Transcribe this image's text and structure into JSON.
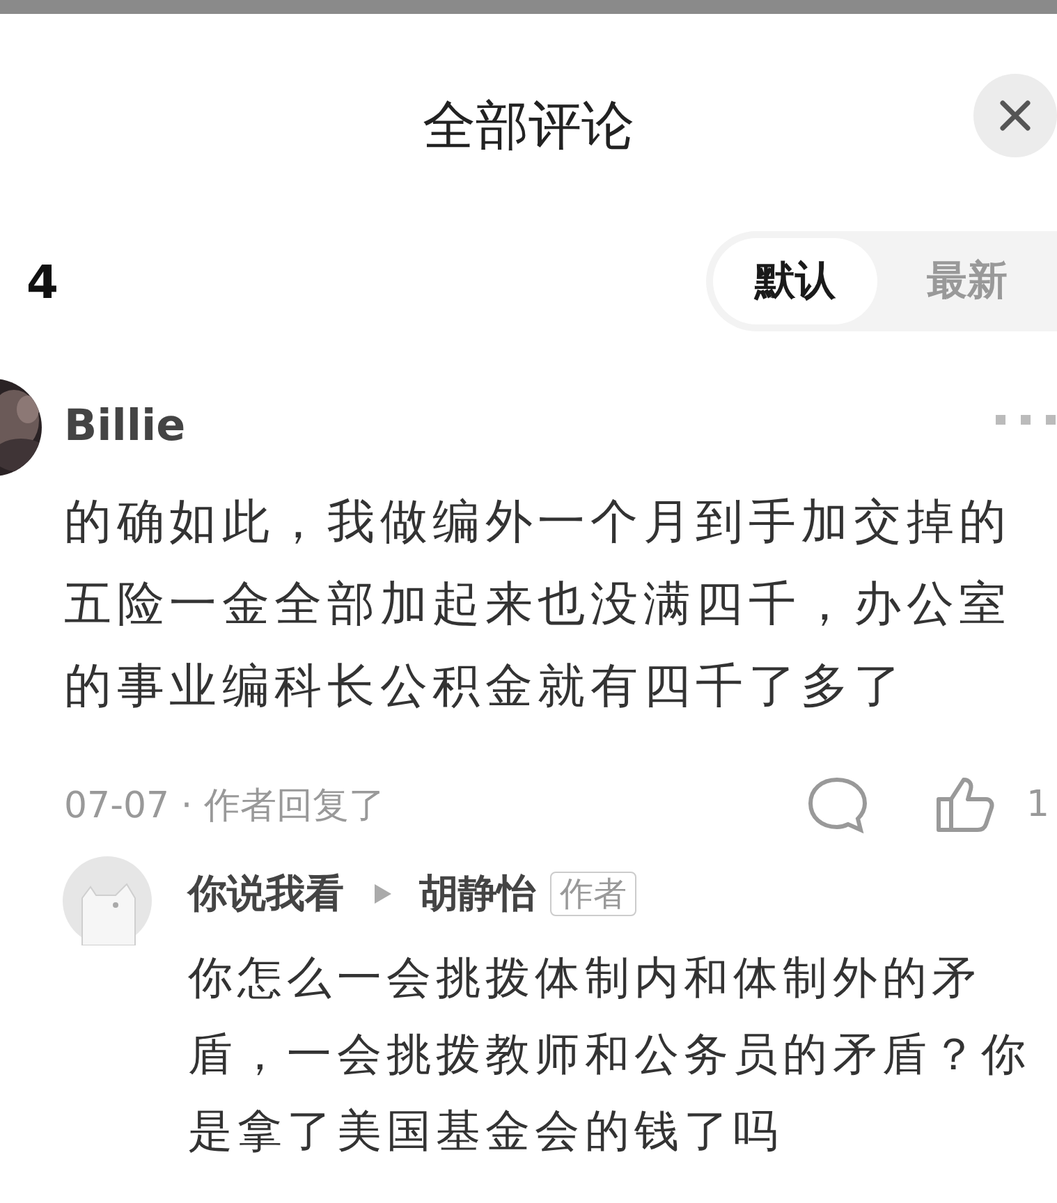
{
  "header": {
    "title": "全部评论"
  },
  "comments_heading": {
    "text": "4"
  },
  "sort_tabs": [
    {
      "label": "默认",
      "selected": true
    },
    {
      "label": "最新",
      "selected": false
    }
  ],
  "comment": {
    "author": "Billie",
    "text": "的确如此，我做编外一个月到手加交掉的五险一金全部加起来也没满四千，办公室的事业编科长公积金就有四千了多了",
    "meta": "07-07 · 作者回复了",
    "like_count": "1"
  },
  "reply": {
    "author": "你说我看",
    "reply_to": "胡静怡",
    "badge": "作者",
    "text": "你怎么一会挑拨体制内和体制外的矛盾，一会挑拨教师和公务员的矛盾？你是拿了美国基金会的钱了吗"
  }
}
